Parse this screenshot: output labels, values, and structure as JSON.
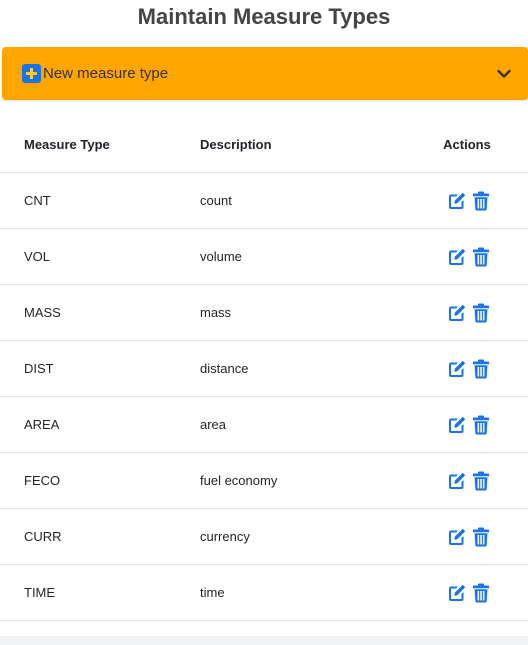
{
  "page": {
    "title": "Maintain Measure Types"
  },
  "accordion": {
    "label": "New measure type",
    "icon": "plus-square-icon",
    "toggle_icon": "chevron-down-icon",
    "color": "#ffa500"
  },
  "table": {
    "headers": {
      "type": "Measure Type",
      "description": "Description",
      "actions": "Actions"
    },
    "rows": [
      {
        "type": "CNT",
        "description": "count"
      },
      {
        "type": "VOL",
        "description": "volume"
      },
      {
        "type": "MASS",
        "description": "mass"
      },
      {
        "type": "DIST",
        "description": "distance"
      },
      {
        "type": "AREA",
        "description": "area"
      },
      {
        "type": "FECO",
        "description": "fuel economy"
      },
      {
        "type": "CURR",
        "description": "currency"
      },
      {
        "type": "TIME",
        "description": "time"
      }
    ],
    "action_icons": [
      "edit-icon",
      "trash-icon"
    ],
    "icon_color": "#1a73e8"
  }
}
